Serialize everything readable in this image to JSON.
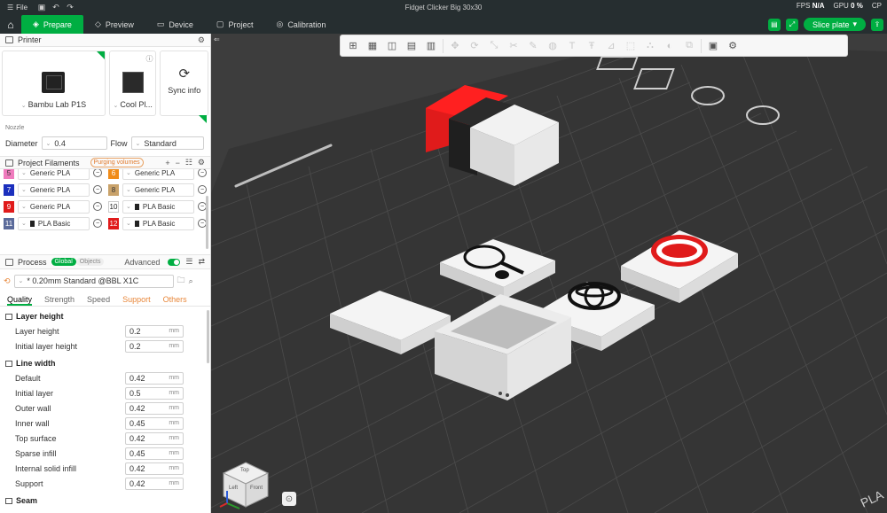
{
  "titlebar": {
    "file_label": "File",
    "title": "Fidget Clicker Big 30x30"
  },
  "nav": {
    "tabs": [
      {
        "label": "Prepare",
        "icon": "prepare-icon"
      },
      {
        "label": "Preview",
        "icon": "preview-icon"
      },
      {
        "label": "Device",
        "icon": "device-icon"
      },
      {
        "label": "Project",
        "icon": "project-icon"
      },
      {
        "label": "Calibration",
        "icon": "calibration-icon"
      }
    ],
    "slice_label": "Slice plate",
    "stats": {
      "fps_label": "FPS",
      "fps_value": "N/A",
      "gpu_label": "GPU",
      "gpu_value": "0 %",
      "cpu_label": "CP"
    }
  },
  "printer": {
    "title": "Printer",
    "printer_name": "Bambu Lab P1S",
    "plate_name": "Cool Pl...",
    "sync_label": "Sync info",
    "nozzle_label": "Nozzle",
    "diameter_label": "Diameter",
    "diameter_value": "0.4",
    "flow_label": "Flow",
    "flow_value": "Standard"
  },
  "filaments": {
    "title": "Project Filaments",
    "purge_label": "Purging volumes",
    "items": [
      {
        "num": "5",
        "color": "#ef7bbd",
        "name": "Generic PLA",
        "spool": false
      },
      {
        "num": "6",
        "color": "#f08c1a",
        "name": "Generic PLA",
        "spool": false
      },
      {
        "num": "7",
        "color": "#1b2fbd",
        "name": "Generic PLA",
        "spool": false
      },
      {
        "num": "8",
        "color": "#c9a26a",
        "name": "Generic PLA",
        "spool": false
      },
      {
        "num": "9",
        "color": "#e01b1b",
        "name": "Generic PLA",
        "spool": false
      },
      {
        "num": "10",
        "color": "#ffffff",
        "name": "PLA Basic",
        "spool": true
      },
      {
        "num": "11",
        "color": "#5a6a9a",
        "name": "PLA Basic",
        "spool": true
      },
      {
        "num": "12",
        "color": "#e01b1b",
        "name": "PLA Basic",
        "spool": true
      }
    ]
  },
  "process": {
    "title": "Process",
    "global_label": "Global",
    "objects_label": "Objects",
    "advanced_label": "Advanced",
    "preset": "* 0.20mm Standard @BBL X1C",
    "tabs": [
      "Quality",
      "Strength",
      "Speed",
      "Support",
      "Others"
    ],
    "groups": [
      {
        "title": "Layer height",
        "rows": [
          {
            "label": "Layer height",
            "value": "0.2",
            "unit": "mm"
          },
          {
            "label": "Initial layer height",
            "value": "0.2",
            "unit": "mm"
          }
        ]
      },
      {
        "title": "Line width",
        "rows": [
          {
            "label": "Default",
            "value": "0.42",
            "unit": "mm"
          },
          {
            "label": "Initial layer",
            "value": "0.5",
            "unit": "mm"
          },
          {
            "label": "Outer wall",
            "value": "0.42",
            "unit": "mm"
          },
          {
            "label": "Inner wall",
            "value": "0.45",
            "unit": "mm"
          },
          {
            "label": "Top surface",
            "value": "0.42",
            "unit": "mm"
          },
          {
            "label": "Sparse infill",
            "value": "0.45",
            "unit": "mm"
          },
          {
            "label": "Internal solid infill",
            "value": "0.42",
            "unit": "mm"
          },
          {
            "label": "Support",
            "value": "0.42",
            "unit": "mm"
          }
        ]
      },
      {
        "title": "Seam",
        "rows": []
      }
    ]
  },
  "viewport": {
    "plate_label": "PLA",
    "cube_labels": {
      "top": "Top",
      "left": "Left",
      "front": "Front"
    },
    "toolbar_icons": [
      "add-icon",
      "arrange-grid-icon",
      "orient-icon",
      "split-icon",
      "layers-icon",
      "move-icon",
      "rotate-icon",
      "scale-icon",
      "cut-icon",
      "paint-icon",
      "seam-icon",
      "text-icon",
      "emboss-icon",
      "measure-icon",
      "assembly-icon",
      "support-paint-icon",
      "color-paint-icon",
      "mesh-boolean-icon",
      "view-icon",
      "settings-icon"
    ]
  }
}
